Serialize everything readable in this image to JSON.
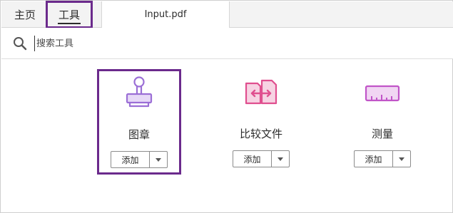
{
  "tabs": {
    "home_label": "主页",
    "tools_label": "工具",
    "doc_label": "Input.pdf"
  },
  "search": {
    "placeholder": "搜索工具",
    "icon": "search-icon"
  },
  "tools": [
    {
      "label": "图章",
      "icon": "stamp-icon",
      "add_label": "添加",
      "color": "#9b6fd6"
    },
    {
      "label": "比较文件",
      "icon": "compare-files-icon",
      "add_label": "添加",
      "color": "#e04f8f"
    },
    {
      "label": "测量",
      "icon": "ruler-icon",
      "add_label": "添加",
      "color": "#c155c8"
    }
  ],
  "colors": {
    "highlight": "#6b2a8c",
    "stamp": "#9b6fd6",
    "compare": "#e04f8f",
    "measure": "#c155c8"
  }
}
